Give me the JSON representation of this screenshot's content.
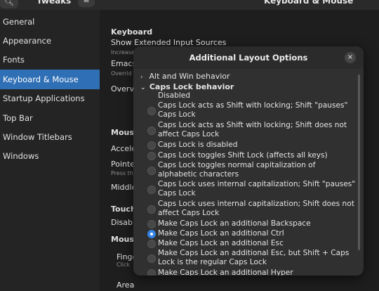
{
  "window": {
    "app_title": "Tweaks",
    "page_title": "Keyboard & Mouse"
  },
  "sidebar": {
    "items": [
      {
        "label": "General"
      },
      {
        "label": "Appearance"
      },
      {
        "label": "Fonts"
      },
      {
        "label": "Keyboard & Mouse",
        "active": true
      },
      {
        "label": "Startup Applications"
      },
      {
        "label": "Top Bar"
      },
      {
        "label": "Window Titlebars"
      },
      {
        "label": "Windows"
      }
    ]
  },
  "main": {
    "keyboard_heading": "Keyboard",
    "show_ext_sources": "Show Extended Input Sources",
    "increase_hint": "Increase",
    "emacs_label": "Emacs",
    "override_hint": "Overrid",
    "overview_label": "Overvi",
    "mouse_heading": "Mouse",
    "accel_label": "Accele",
    "pointer_label": "Pointe",
    "press_hint": "Press th",
    "middle_label": "Middle",
    "touch_heading": "Touch",
    "disable_label": "Disabl",
    "mouse2_heading": "Mouse",
    "finger_label": "Finge",
    "click_hint": "Click",
    "area_label": "Area"
  },
  "dialog": {
    "title": "Additional Layout Options",
    "close_icon": "×",
    "groups": [
      {
        "label": "Alt and Win behavior",
        "expanded": false
      },
      {
        "label": "Caps Lock behavior",
        "expanded": true
      }
    ],
    "options": [
      {
        "label": "Disabled",
        "selected": false
      },
      {
        "label": "Caps Lock acts as Shift with locking; Shift \"pauses\" Caps Lock",
        "selected": false
      },
      {
        "label": "Caps Lock acts as Shift with locking; Shift does not affect Caps Lock",
        "selected": false
      },
      {
        "label": "Caps Lock is disabled",
        "selected": false
      },
      {
        "label": "Caps Lock toggles Shift Lock (affects all keys)",
        "selected": false
      },
      {
        "label": "Caps Lock toggles normal capitalization of alphabetic characters",
        "selected": false
      },
      {
        "label": "Caps Lock uses internal capitalization; Shift \"pauses\" Caps Lock",
        "selected": false
      },
      {
        "label": "Caps Lock uses internal capitalization; Shift does not affect Caps Lock",
        "selected": false
      },
      {
        "label": "Make Caps Lock an additional Backspace",
        "selected": false
      },
      {
        "label": "Make Caps Lock an additional Ctrl",
        "selected": true
      },
      {
        "label": "Make Caps Lock an additional Esc",
        "selected": false
      },
      {
        "label": "Make Caps Lock an additional Esc, but Shift + Caps Lock is the regular Caps Lock",
        "selected": false
      },
      {
        "label": "Make Caps Lock an additional Hyper",
        "selected": false
      }
    ]
  },
  "colors": {
    "accent": "#3584e4",
    "sidebar_active": "#2f6fb5"
  },
  "icons": {
    "search": "search-icon",
    "menu": "hamburger-menu-icon",
    "close": "close-icon",
    "chevron_right": "chevron-right-icon",
    "chevron_down": "chevron-down-icon"
  }
}
